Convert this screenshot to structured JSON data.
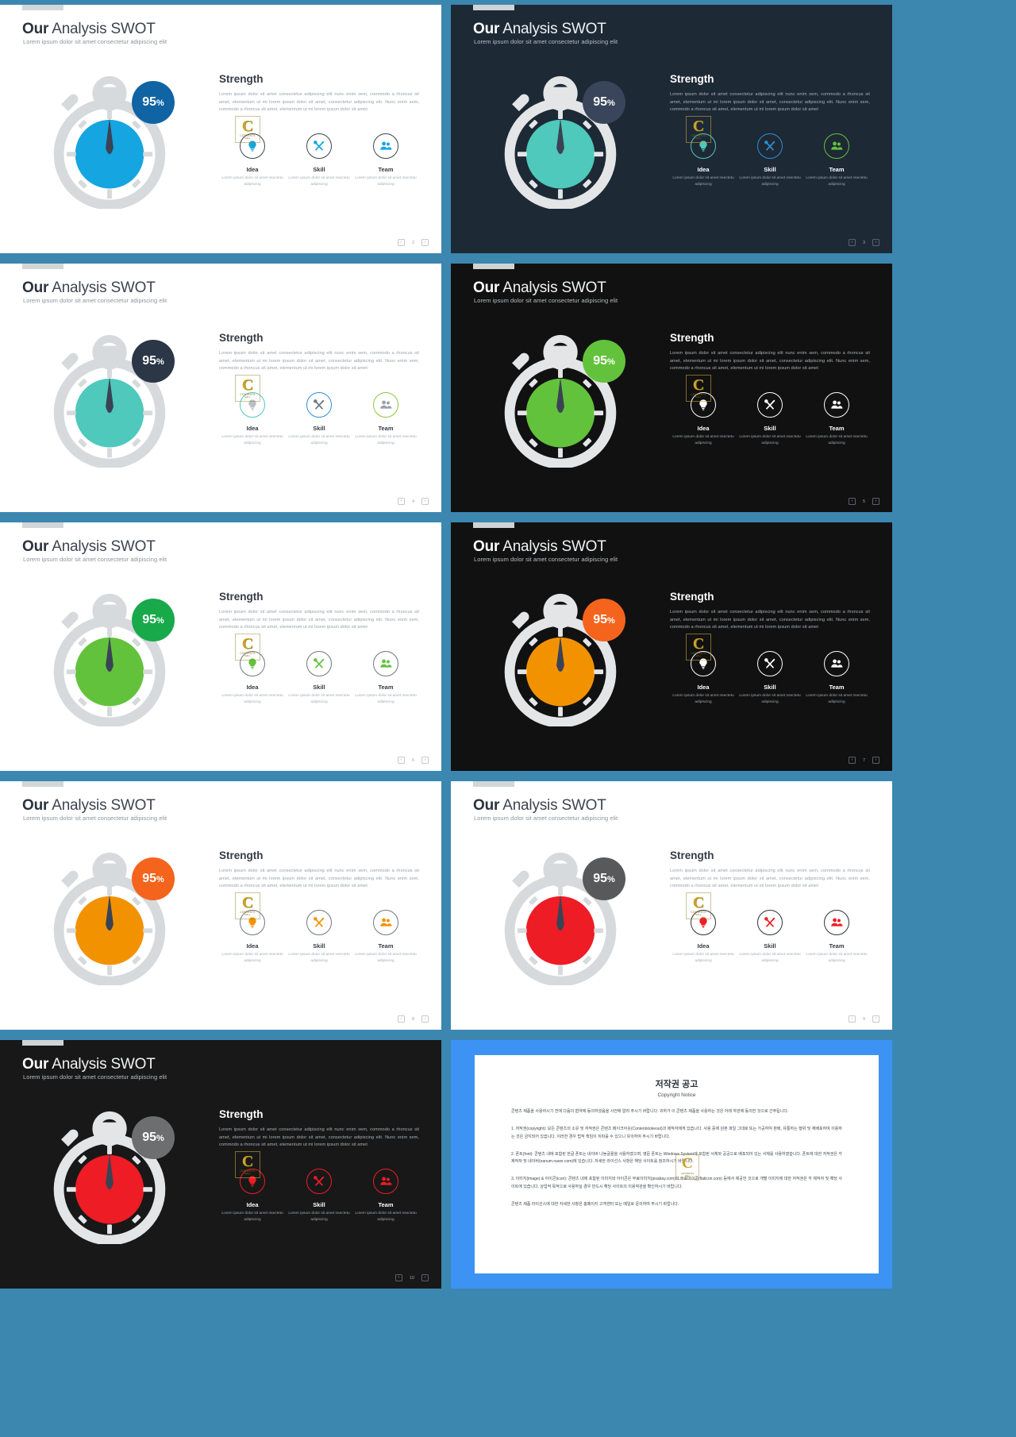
{
  "deck": {
    "title_bold": "Our",
    "title_rest": " Analysis SWOT",
    "subtitle": "Lorem ipsum dolor sit amet consectetur adipiscing elit",
    "section_heading": "Strength",
    "percent_value": "95",
    "percent_symbol": "%",
    "body_text": "Lorem ipsum dolor sit amet consectetur adipiscing elit nunc enim sem, commodo a rhoncus sit amet, elementum ut mi lorem ipsum dolor sit amet, consectetur adipiscing elit. Nunc enim sem, commodo a rhoncus sit amet, elementum ut mi lorem ipsum dolor sit amet",
    "card_desc": "Lorem ipsum dolor sit amet nsectetu adipiscing",
    "cards": [
      {
        "label": "Idea",
        "icon": "lightbulb-icon"
      },
      {
        "label": "Skill",
        "icon": "tools-icon"
      },
      {
        "label": "Team",
        "icon": "people-icon"
      }
    ],
    "pager": {
      "prev": "‹",
      "next": "›"
    },
    "watermark": {
      "letter": "C",
      "line1": "CONTENTS",
      "line2": "MALL"
    }
  },
  "colors": {
    "page_background": "#3b87b0",
    "blue": "#15a5e0",
    "blue_dark": "#1064a3",
    "teal": "#4ec9bc",
    "navy": "#1e2936",
    "green": "#63c23c",
    "orange": "#f39200",
    "red": "#ee1c25",
    "grey": "#58595b",
    "light_grey_dial": "#d7dadc",
    "copyright_blue": "#3d93f3"
  },
  "slides": [
    {
      "n": "2",
      "theme": "light",
      "dial": "#15a5e0",
      "bubble": "#1064a3",
      "icon": "#15a5e0",
      "ring": "#3d4550",
      "wm": true
    },
    {
      "n": "3",
      "theme": "navy",
      "dial": "#4ec9bc",
      "bubble": "#39455a",
      "icon_list": [
        "#4ec9bc",
        "#2f8fd4",
        "#63c23c"
      ],
      "ring_list": [
        "#4ec9bc",
        "#2f8fd4",
        "#63c23c"
      ],
      "wm": true
    },
    {
      "n": "4",
      "theme": "light",
      "dial": "#4ec9bc",
      "bubble": "#2b3647",
      "icon_list": [
        "#b9bfc4",
        "#6e7880",
        "#9aa1a8"
      ],
      "ring_list": [
        "#4ec9bc",
        "#2f8fd4",
        "#8ec63f"
      ],
      "wm": true
    },
    {
      "n": "5",
      "theme": "black",
      "dial": "#63c23c",
      "bubble": "#63c23c",
      "icon": "#ffffff",
      "ring": "#ffffff",
      "wm": true
    },
    {
      "n": "6",
      "theme": "light",
      "dial": "#63c23c",
      "bubble": "#18a94a",
      "icon": "#63c23c",
      "ring": "#6e7880",
      "wm": true
    },
    {
      "n": "7",
      "theme": "black",
      "dial": "#f39200",
      "bubble": "#f4641d",
      "icon": "#ffffff",
      "ring": "#ffffff",
      "wm": true
    },
    {
      "n": "8",
      "theme": "light",
      "dial": "#f39200",
      "bubble": "#f4641d",
      "icon": "#f39200",
      "ring": "#6e7880",
      "wm": true
    },
    {
      "n": "9",
      "theme": "light",
      "dial": "#ee1c25",
      "bubble": "#58595b",
      "icon": "#ee1c25",
      "ring": "#2b323c",
      "wm": true
    },
    {
      "n": "10",
      "theme": "dark2",
      "dial": "#ee1c25",
      "bubble": "#6d6e70",
      "icon": "#ee1c25",
      "ring": "#ee1c25",
      "wm": true
    }
  ],
  "copyright": {
    "ko_title": "저작권 공고",
    "en_title": "Copyright Notice",
    "intro": "콘텐츠 제품을 사용하시기 전에 다음의 협약에 동의하셨음을 사전에 알려 주시기 바랍니다. 귀하가 이 콘텐츠 제품을 사용하는 것은 아래 약관에 동의한 것으로 간주됩니다.",
    "items": [
      "1. 저작권(copyright): 모든 콘텐츠의 소유 및 저작권은 콘텐츠 메이크아웃(Contentstokeout)과 제작자에게 있습니다. 사용 중에 원본 파일 그대로 또는 가공하여 판매, 유통하는 행위 및 재배포하여 이용하는 것은 금지되어 있습니다. 이러한 경우 법적 책임이 뒤따를 수 있으니 유의하여 주시기 바랍니다.",
      "2. 폰트(font): 콘텐츠 내에 포함된 한글 폰트는 네이버 나눔글꼴을 사용하였으며, 영문 폰트는 Windows System에 포함된 서체와 공공으로 배포되어 있는 서체를 사용하였습니다. 폰트에 대한 저작권은 각 제작자 및 네이버(nanum.naver.com)에 있습니다. 자세한 라이선스 사항은 해당 사이트를 참조하시기 바랍니다.",
      "3. 이미지(image) & 아이콘(icon): 콘텐츠 내에 포함된 이미지와 아이콘은 무료이미지(pixabay.com)와 무료아이콘(flaticon.com) 등에서 제공한 것으로 개별 이미지에 대한 저작권은 각 제작자 및 해당 사이트에 있습니다. 상업적 목적으로 사용하실 경우 반드시 해당 사이트의 이용약관을 확인하시기 바랍니다."
    ],
    "footer": "콘텐츠 제품 라이선스에 대한 자세한 사항은 홈페이지 고객센터 또는 메일로 문의하여 주시기 바랍니다."
  }
}
